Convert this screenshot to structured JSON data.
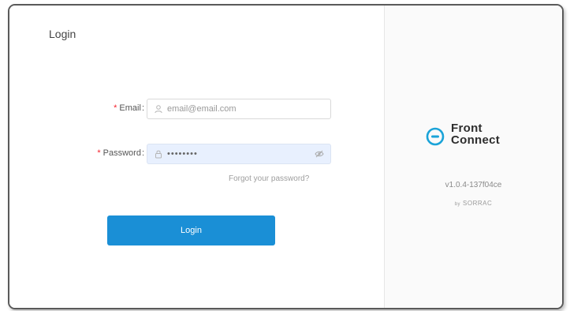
{
  "page": {
    "title": "Login"
  },
  "form": {
    "email": {
      "label": "Email",
      "required_marker": "*",
      "value": "email@email.com"
    },
    "password": {
      "label": "Password",
      "required_marker": "*",
      "value": "••••••••"
    },
    "forgot_link": "Forgot your password?",
    "submit_label": "Login"
  },
  "brand": {
    "name_line1": "Front",
    "name_line2": "Connect",
    "version": "v1.0.4-137f04ce",
    "by_prefix": "by",
    "company": "SORRAC"
  },
  "colors": {
    "accent": "#1a8fd6",
    "required": "#f5222d",
    "logo_teal": "#1aa3d8"
  },
  "icons": {
    "email": "user-icon",
    "password": "lock-icon",
    "password_toggle": "eye-icon",
    "brand": "front-connect-logo-icon"
  }
}
